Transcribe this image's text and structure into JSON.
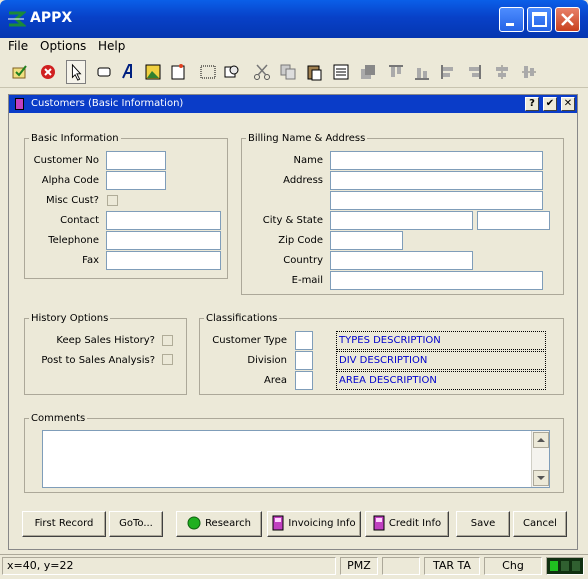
{
  "window": {
    "title": "APPX"
  },
  "menu": {
    "file": "File",
    "options": "Options",
    "help": "Help"
  },
  "toolbar": {
    "icons": [
      "save-check-icon",
      "stop-icon",
      "pointer-icon",
      "rectangle-icon",
      "text-a-icon",
      "image-icon",
      "new-page-icon",
      "frame-icon",
      "search-icon",
      "cut-icon",
      "copy-icon",
      "paste-icon",
      "list-icon",
      "bring-front-icon",
      "align-top-icon",
      "align-bottom-icon",
      "align-left-icon",
      "align-right-icon",
      "center-h-icon",
      "center-v-icon"
    ]
  },
  "dialog": {
    "title": "Customers (Basic Information)",
    "help_btn": "?",
    "ok_btn": "✔",
    "close_btn": "✕"
  },
  "basic": {
    "legend": "Basic Information",
    "customer_no": "Customer No",
    "alpha_code": "Alpha Code",
    "misc_cust": "Misc Cust?",
    "contact": "Contact",
    "telephone": "Telephone",
    "fax": "Fax"
  },
  "billing": {
    "legend": "Billing Name & Address",
    "name": "Name",
    "address": "Address",
    "city_state": "City & State",
    "zip_code": "Zip Code",
    "country": "Country",
    "email": "E-mail"
  },
  "history": {
    "legend": "History Options",
    "keep_sales": "Keep Sales History?",
    "post_sales": "Post to Sales Analysis?"
  },
  "classifications": {
    "legend": "Classifications",
    "customer_type": "Customer Type",
    "division": "Division",
    "area": "Area",
    "types_desc": "TYPES DESCRIPTION",
    "div_desc": "DIV DESCRIPTION",
    "area_desc": "AREA DESCRIPTION"
  },
  "comments": {
    "legend": "Comments"
  },
  "buttons": {
    "first_record": "First Record",
    "goto": "GoTo...",
    "research": "Research",
    "invoicing": "Invoicing Info",
    "credit": "Credit Info",
    "save": "Save",
    "cancel": "Cancel"
  },
  "status": {
    "coords": "x=40, y=22",
    "pmz": "PMZ",
    "blank": "",
    "tar": "TAR TA",
    "chg": "Chg"
  },
  "colors": {
    "accent": "#0A3CC8",
    "desc_text": "#0000CC",
    "research_green": "#20B020",
    "status_green": "#20C020"
  }
}
